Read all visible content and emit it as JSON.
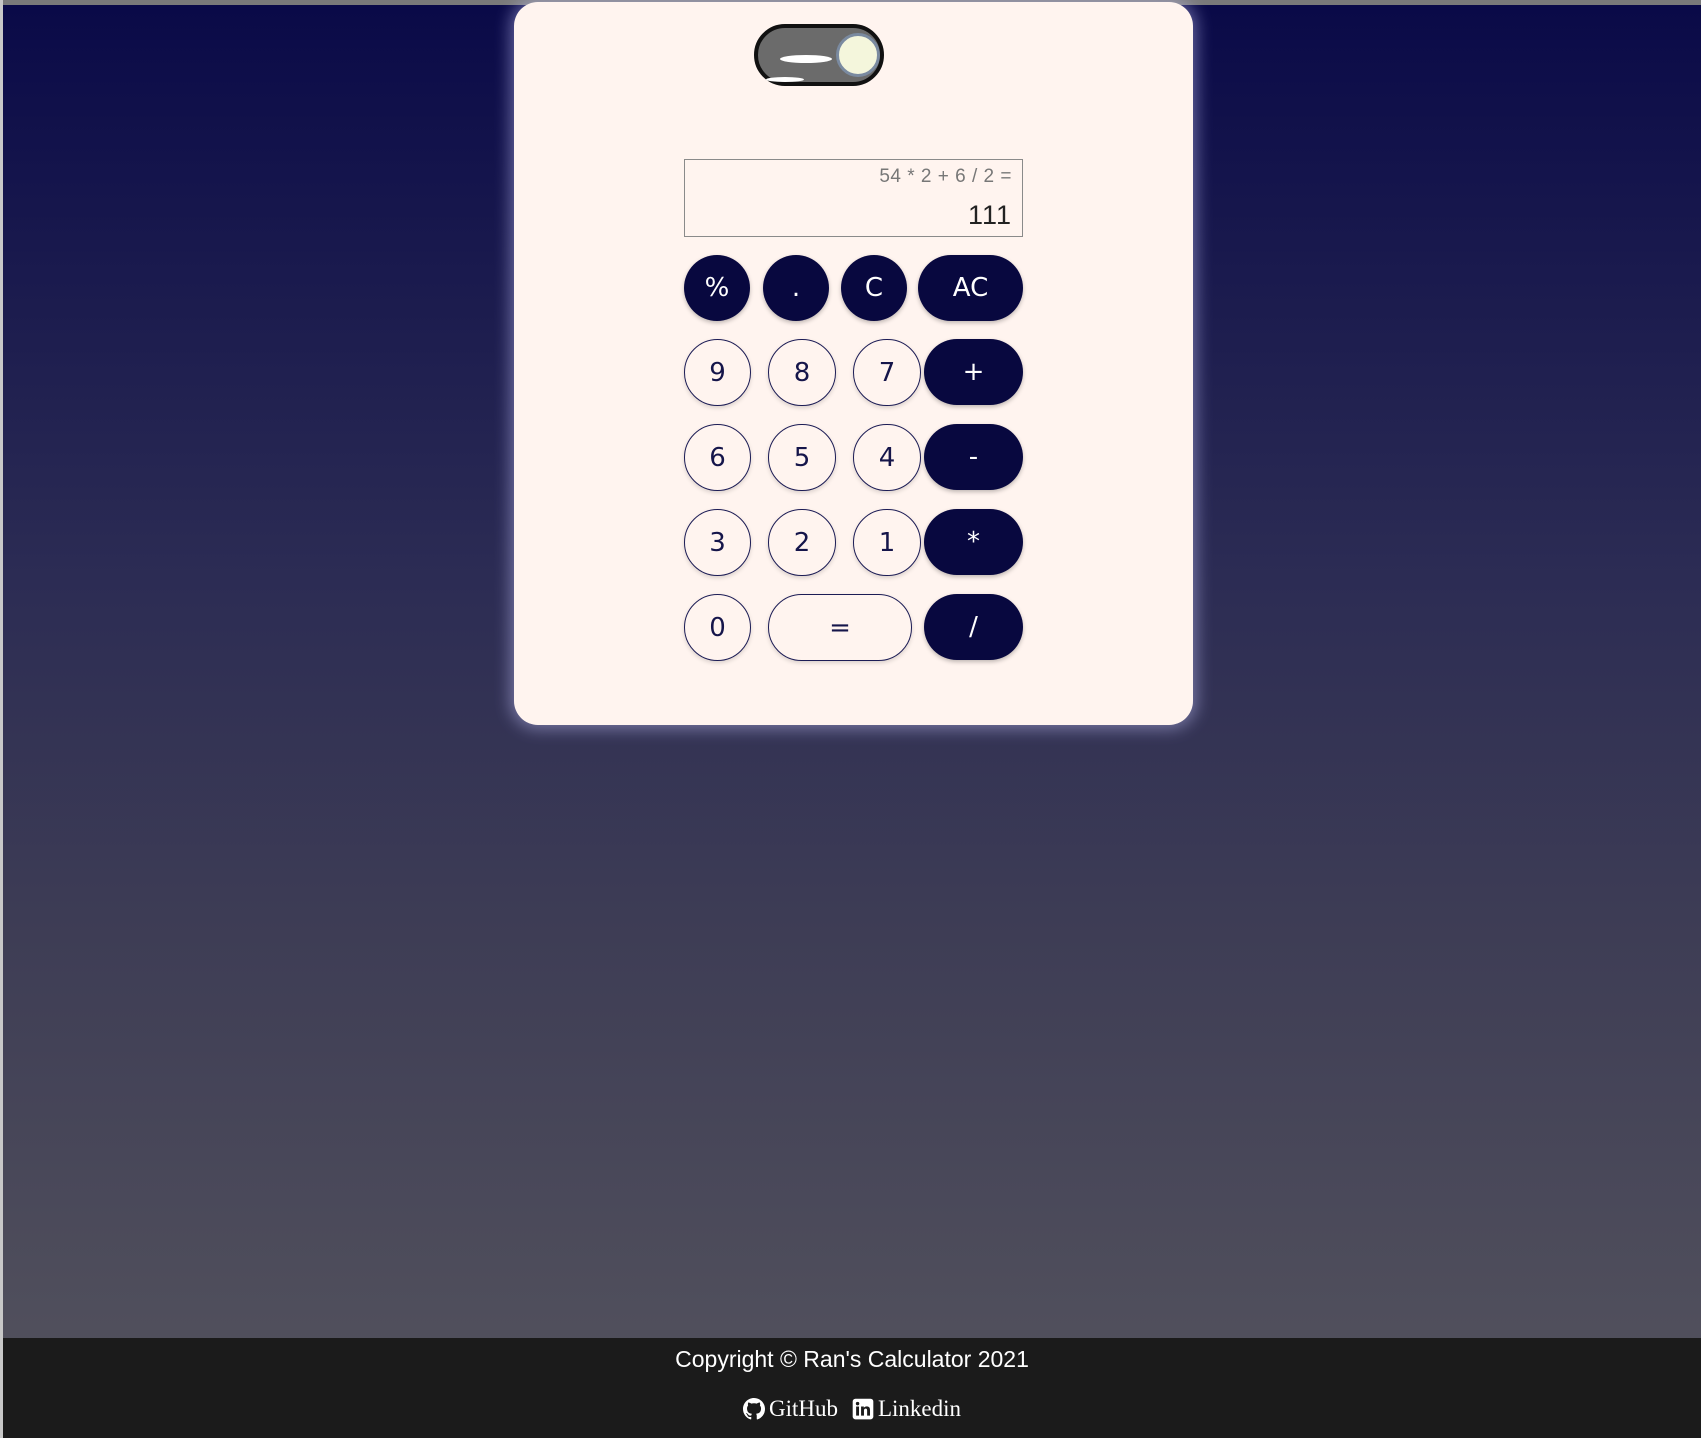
{
  "theme_toggle": {
    "state": "dark-mode-off"
  },
  "display": {
    "expression": "54 * 2 + 6 / 2 =",
    "result": "111"
  },
  "keypad": {
    "percent": "%",
    "dot": ".",
    "clear": "C",
    "all_clear": "AC",
    "nine": "9",
    "eight": "8",
    "seven": "7",
    "plus": "+",
    "six": "6",
    "five": "5",
    "four": "4",
    "minus": "-",
    "three": "3",
    "two": "2",
    "one": "1",
    "multiply": "*",
    "zero": "0",
    "equals": "=",
    "divide": "/"
  },
  "footer": {
    "copyright": "Copyright © Ran's Calculator 2021",
    "github_label": "GitHub",
    "linkedin_label": "Linkedin"
  },
  "colors": {
    "dark_button": "#08083f",
    "card_background": "#fff4ef",
    "footer_background": "#1b1b1b"
  },
  "icons": {
    "github": "github-icon",
    "linkedin": "linkedin-icon"
  }
}
